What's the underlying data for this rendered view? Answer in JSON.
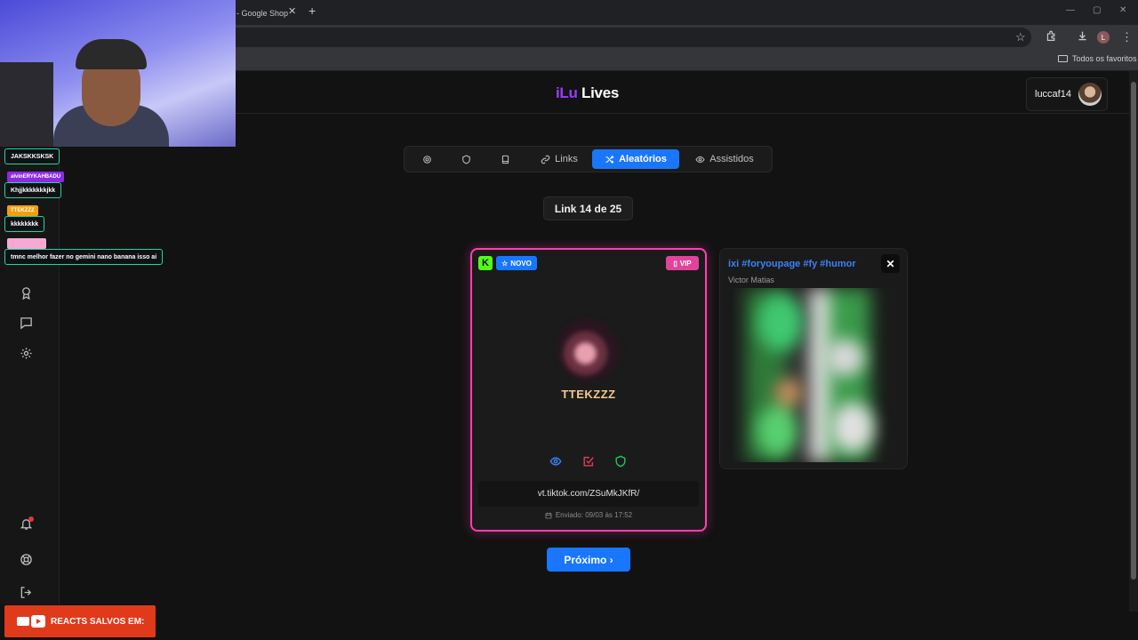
{
  "browser": {
    "tab_title": "- Google Shop",
    "tab_close": "✕",
    "new_tab": "+",
    "window_controls": [
      "—",
      "▢",
      "✕"
    ],
    "toolbar_icons": [
      "star-icon",
      "extensions-icon",
      "download-icon",
      "menu-icon"
    ],
    "profile_initial": "L",
    "bookmarks_label": "Todos os favoritos"
  },
  "header": {
    "logo_part1": "iLu",
    "logo_part2": "Lives",
    "username": "luccaf14"
  },
  "sidebar": {
    "items": [
      "award-icon",
      "chat-icon",
      "settings-icon",
      "bell-icon",
      "help-icon",
      "logout-icon"
    ]
  },
  "nav": {
    "tabs": [
      {
        "icon": "gear-icon",
        "label": ""
      },
      {
        "icon": "shield-icon",
        "label": ""
      },
      {
        "icon": "book-icon",
        "label": ""
      },
      {
        "icon": "link-icon",
        "label": "Links"
      },
      {
        "icon": "shuffle-icon",
        "label": "Aleatórios",
        "active": true
      },
      {
        "icon": "eye-icon",
        "label": "Assistidos"
      }
    ]
  },
  "counter": "Link 14 de 25",
  "card": {
    "kick_letter": "K",
    "novo_label": "NOVO",
    "vip_label": "VIP",
    "name": "TTEKZZZ",
    "link": "vt.tiktok.com/ZSuMkJKfR/",
    "sent": "Enviado: 09/03 às 17:52",
    "accent_color": "#ff3fb0"
  },
  "side_card": {
    "title": "ixi #foryoupage #fy #humor",
    "author": "Victor Matias",
    "close": "✕"
  },
  "next_button": "Próximo ›",
  "stream_overlay": {
    "chat": [
      {
        "user": "",
        "message": "JAKSKKSKSK",
        "color": "#1fd6a0"
      },
      {
        "user": "alvinERYKAHBADU",
        "message": "Khjjkkkkkkkjkk",
        "color": "#8a2be2"
      },
      {
        "user": "TTEKZZZ",
        "message": "kkkkkkkk",
        "color": "#f59e0b"
      },
      {
        "user": "",
        "message": "tmnc melhor fazer no gemini nano banana isso ai",
        "color": "#f9a8d4"
      }
    ],
    "promo_text": "REACTS SALVOS EM:"
  }
}
